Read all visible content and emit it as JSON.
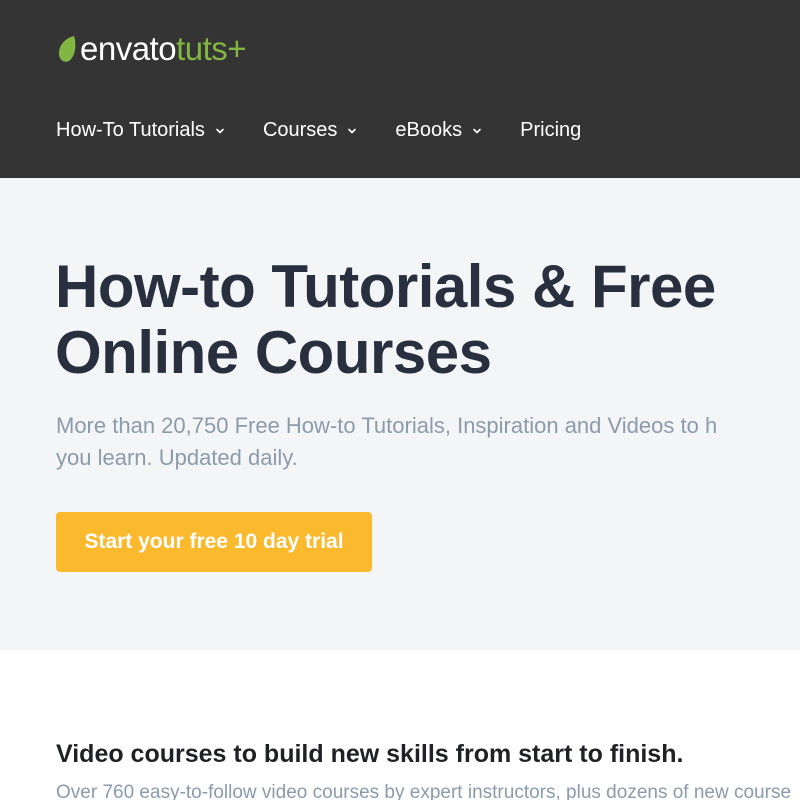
{
  "header": {
    "logo": {
      "envato": "envato",
      "tuts": "tuts+",
      "icon": "envato-leaf-icon",
      "leaf_color": "#82b541"
    },
    "nav": [
      {
        "label": "How-To Tutorials",
        "has_dropdown": true
      },
      {
        "label": "Courses",
        "has_dropdown": true
      },
      {
        "label": "eBooks",
        "has_dropdown": true
      },
      {
        "label": "Pricing",
        "has_dropdown": false
      }
    ],
    "background": "#343434"
  },
  "hero": {
    "title": "How-to Tutorials & Free Online Courses",
    "subtitle_line1": "More than 20,750 Free How-to Tutorials, Inspiration and Videos to h",
    "subtitle_line2": "you learn. Updated daily.",
    "cta_label": "Start your free 10 day trial",
    "cta_color": "#fbb92e",
    "background": "#f4f5f7"
  },
  "courses_section": {
    "title": "Video courses to build new skills from start to finish.",
    "subtitle": "Over 760 easy-to-follow video courses by expert instructors, plus dozens of new course"
  }
}
